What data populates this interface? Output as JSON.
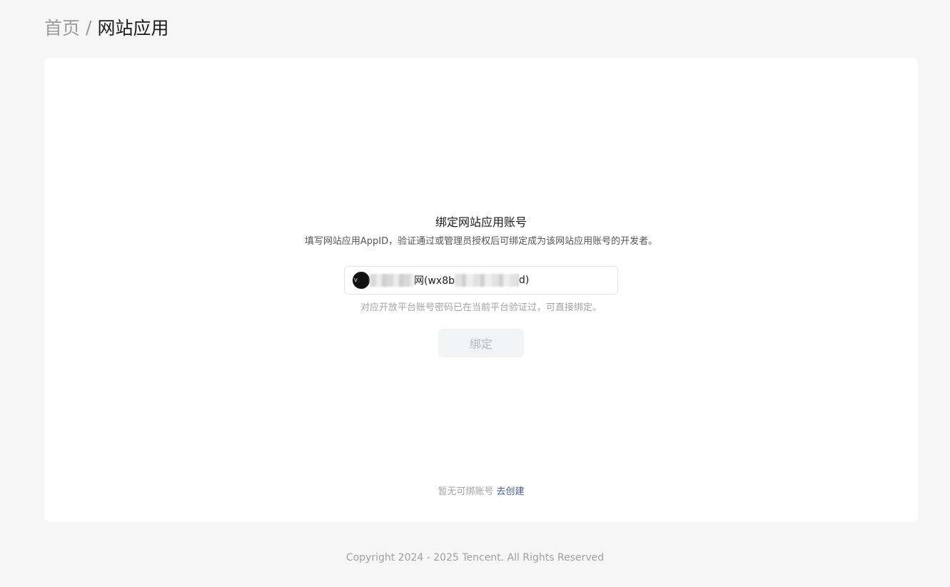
{
  "breadcrumb": {
    "home": "首页",
    "separator": "/",
    "current": "网站应用"
  },
  "bind_panel": {
    "title": "绑定网站应用账号",
    "description": "填写网站应用AppID，验证通过或管理员授权后可绑定成为该网站应用账号的开发者。",
    "selected_account": {
      "avatar_text": "V",
      "name_suffix": "网(wx8b",
      "id_suffix": "d)"
    },
    "hint": "对应开放平台账号密码已在当前平台验证过，可直接绑定。",
    "bind_button": "绑定",
    "bind_button_state": "disabled"
  },
  "empty_state": {
    "text": "暂无可绑账号",
    "create_link": "去创建"
  },
  "footer": {
    "copyright": "Copyright 2024 - 2025 Tencent. All Rights Reserved"
  },
  "colors": {
    "background": "#f6f6f6",
    "card": "#ffffff",
    "link": "#4a5f8a",
    "disabled_button_bg": "#f2f3f5"
  }
}
